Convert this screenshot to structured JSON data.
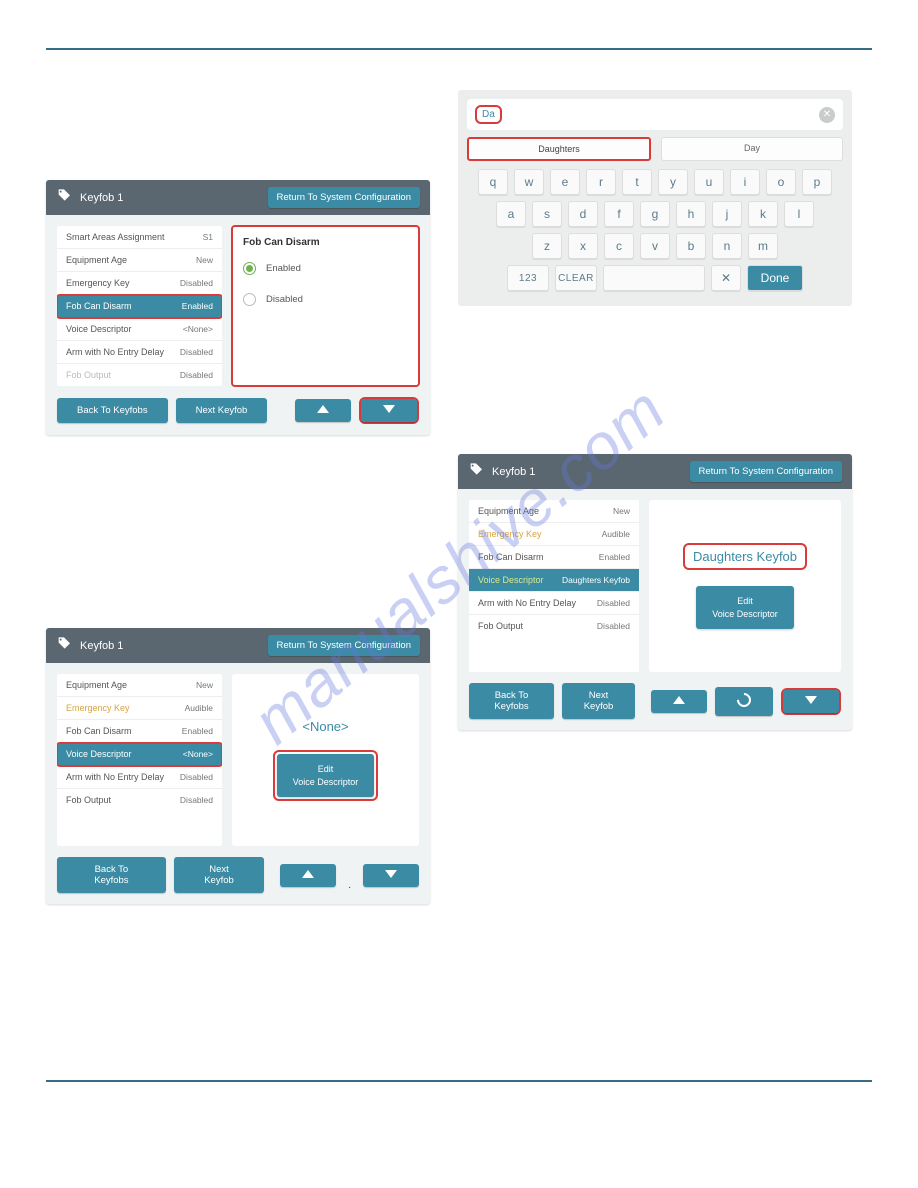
{
  "watermark": "manualshive.com",
  "panels": {
    "p1": {
      "title": "Keyfob 1",
      "return_btn": "Return To System Configuration",
      "items": [
        {
          "label": "Smart Areas Assignment",
          "value": "S1"
        },
        {
          "label": "Equipment Age",
          "value": "New"
        },
        {
          "label": "Emergency Key",
          "value": "Disabled"
        },
        {
          "label": "Fob Can Disarm",
          "value": "Enabled"
        },
        {
          "label": "Voice Descriptor",
          "value": "<None>"
        },
        {
          "label": "Arm with No Entry Delay",
          "value": "Disabled"
        },
        {
          "label": "Fob Output",
          "value": "Disabled"
        }
      ],
      "detail_title": "Fob Can Disarm",
      "opt_enabled": "Enabled",
      "opt_disabled": "Disabled",
      "back_btn": "Back To Keyfobs",
      "next_btn": "Next Keyfob"
    },
    "kbd": {
      "typed": "Da",
      "sugg1": "Daughters",
      "sugg2": "Day",
      "row1": [
        "q",
        "w",
        "e",
        "r",
        "t",
        "y",
        "u",
        "i",
        "o",
        "p"
      ],
      "row2": [
        "a",
        "s",
        "d",
        "f",
        "g",
        "h",
        "j",
        "k",
        "l"
      ],
      "row3": [
        "z",
        "x",
        "c",
        "v",
        "b",
        "n",
        "m"
      ],
      "num_key": "123",
      "clear_key": "CLEAR",
      "bksp": "✕",
      "done": "Done"
    },
    "p3": {
      "title": "Keyfob 1",
      "return_btn": "Return To System Configuration",
      "items": [
        {
          "label": "Equipment Age",
          "value": "New"
        },
        {
          "label": "Emergency Key",
          "value": "Audible"
        },
        {
          "label": "Fob Can Disarm",
          "value": "Enabled"
        },
        {
          "label": "Voice Descriptor",
          "value": "Daughters Keyfob"
        },
        {
          "label": "Arm with No Entry Delay",
          "value": "Disabled"
        },
        {
          "label": "Fob Output",
          "value": "Disabled"
        }
      ],
      "vd_value": "Daughters Keyfob",
      "vd_btn_l1": "Edit",
      "vd_btn_l2": "Voice Descriptor",
      "back_btn": "Back To Keyfobs",
      "next_btn": "Next Keyfob"
    },
    "p4": {
      "title": "Keyfob 1",
      "return_btn": "Return To System Configuration",
      "items": [
        {
          "label": "Equipment Age",
          "value": "New"
        },
        {
          "label": "Emergency Key",
          "value": "Audible"
        },
        {
          "label": "Fob Can Disarm",
          "value": "Enabled"
        },
        {
          "label": "Voice Descriptor",
          "value": "<None>"
        },
        {
          "label": "Arm with No Entry Delay",
          "value": "Disabled"
        },
        {
          "label": "Fob Output",
          "value": "Disabled"
        }
      ],
      "vd_value": "<None>",
      "vd_btn_l1": "Edit",
      "vd_btn_l2": "Voice Descriptor",
      "back_btn": "Back To Keyfobs",
      "next_btn": "Next Keyfob"
    }
  }
}
